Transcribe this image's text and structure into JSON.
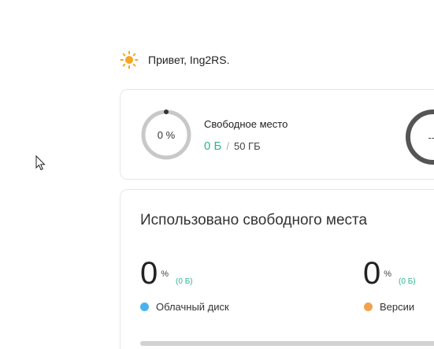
{
  "greeting": {
    "text": "Привет, Ing2RS.",
    "icon": "sun-icon",
    "icon_color": "#f5a623"
  },
  "storage": {
    "free_percent_label": "0 %",
    "free_title": "Свободное место",
    "free_used": "0 Б",
    "separator": "/",
    "free_total": "50 ГБ",
    "second_ring_label": "---"
  },
  "usage": {
    "title": "Использовано свободного места",
    "cloud": {
      "value": "0",
      "unit": "%",
      "size": "(0 Б)",
      "label": "Облачный диск",
      "color": "#4ab3ef"
    },
    "versions": {
      "value": "0",
      "unit": "%",
      "size": "(0 Б)",
      "label": "Версии",
      "color": "#f1a24a"
    }
  },
  "colors": {
    "accent_green": "#2db58e",
    "ring_track": "#c8c8c8",
    "ring_dark": "#555555"
  }
}
